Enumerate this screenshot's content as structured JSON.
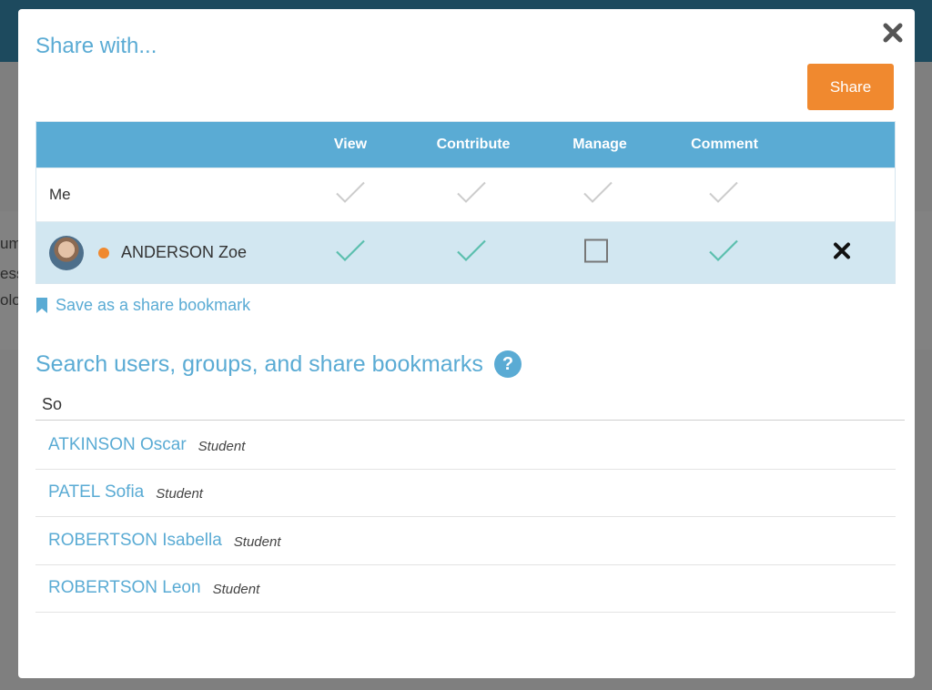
{
  "background": {
    "partial_lines": [
      "um",
      "ess",
      "olo"
    ]
  },
  "modal": {
    "title": "Share with...",
    "share_button": "Share",
    "columns": [
      "View",
      "Contribute",
      "Manage",
      "Comment"
    ],
    "rows": [
      {
        "label": "Me",
        "permissions": {
          "view": "check-disabled",
          "contribute": "check-disabled",
          "manage": "check-disabled",
          "comment": "check-disabled"
        },
        "removable": false
      },
      {
        "label": "ANDERSON Zoe",
        "status": "online",
        "permissions": {
          "view": "checked",
          "contribute": "checked",
          "manage": "unchecked",
          "comment": "checked"
        },
        "removable": true
      }
    ],
    "bookmark_link": "Save as a share bookmark",
    "search_title": "Search users, groups, and share bookmarks",
    "search_value": "So",
    "results": [
      {
        "name": "ATKINSON Oscar",
        "role": "Student"
      },
      {
        "name": "PATEL Sofia",
        "role": "Student"
      },
      {
        "name": "ROBERTSON Isabella",
        "role": "Student"
      },
      {
        "name": "ROBERTSON Leon",
        "role": "Student"
      }
    ],
    "colors": {
      "accent": "#5aabd4",
      "share_button": "#f0892f",
      "selected_row": "#d2e7f1",
      "check": "#5bbfae",
      "check_disabled": "#cccccc"
    }
  }
}
